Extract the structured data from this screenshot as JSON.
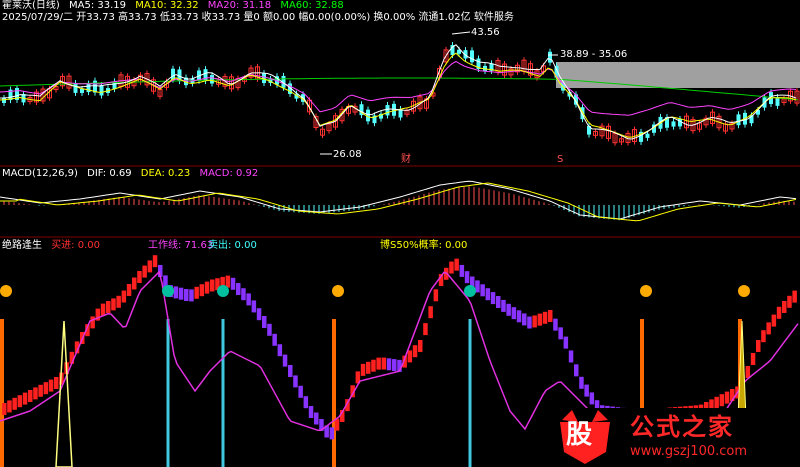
{
  "app": {
    "stock_label": "霍莱沃(日线)",
    "date_label": "2025/07/29/二",
    "ohlc": "开33.73 高33.73 低33.73 收33.73 量0 额0.00 幅0.00(0.00%) 换0.00% 流通1.02亿 软件服务"
  },
  "ma": [
    {
      "label": "MA5: 33.19",
      "color": "#ffffff"
    },
    {
      "label": "MA10: 32.32",
      "color": "#ffff00"
    },
    {
      "label": "MA20: 31.18",
      "color": "#ff44ff"
    },
    {
      "label": "MA60: 32.88",
      "color": "#00ff00"
    }
  ],
  "price_annotations": {
    "high_label": "43.56",
    "low_label": "26.08",
    "range_label": "38.89 - 35.06",
    "marker_cai": "财",
    "marker_s": "S"
  },
  "macd": {
    "title": "MACD(12,26,9)",
    "dif": "DIF: 0.69",
    "dea": "DEA: 0.23",
    "macd": "MACD: 0.92"
  },
  "indicator": {
    "name": "绝路逢生",
    "buy": "买进: 0.00",
    "work_line": "工作线: 71.63",
    "sell": "卖出: 0.00",
    "prob": "博S50%概率: 0.00"
  },
  "watermark": {
    "glyph": "股",
    "name": "公式之家",
    "url": "www.gszj100.com"
  },
  "colors": {
    "up": "#ff3232",
    "down": "#54ffff",
    "grid": "#800000",
    "purple": "#8a2be2",
    "magenta": "#e030e0",
    "work_up": "#ff2020",
    "work_down": "#8833ff"
  }
}
